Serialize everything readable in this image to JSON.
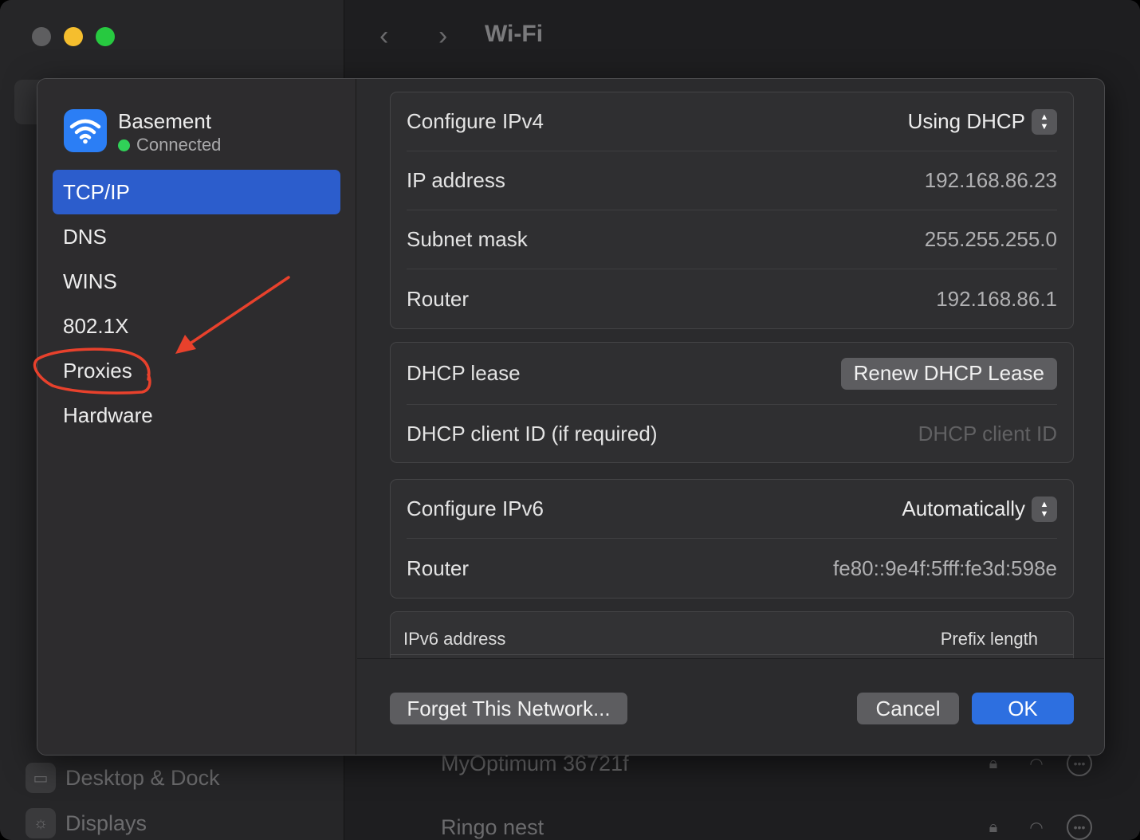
{
  "background_window": {
    "title": "Wi-Fi",
    "sidebar_rows": [
      {
        "label": "Desktop & Dock",
        "icon": "dock-icon"
      },
      {
        "label": "Displays",
        "icon": "displays-icon"
      }
    ],
    "networks": [
      {
        "name": "MyOptimum 36721f"
      },
      {
        "name": "Ringo nest"
      }
    ]
  },
  "sheet": {
    "network": {
      "name": "Basement",
      "status": "Connected"
    },
    "nav": [
      {
        "label": "TCP/IP",
        "active": true
      },
      {
        "label": "DNS"
      },
      {
        "label": "WINS"
      },
      {
        "label": "802.1X"
      },
      {
        "label": "Proxies"
      },
      {
        "label": "Hardware"
      }
    ],
    "ipv4": {
      "configure_label": "Configure IPv4",
      "configure_value": "Using DHCP",
      "ip_label": "IP address",
      "ip_value": "192.168.86.23",
      "subnet_label": "Subnet mask",
      "subnet_value": "255.255.255.0",
      "router_label": "Router",
      "router_value": "192.168.86.1"
    },
    "dhcp": {
      "lease_label": "DHCP lease",
      "renew_button": "Renew DHCP Lease",
      "client_id_label": "DHCP client ID (if required)",
      "client_id_placeholder": "DHCP client ID"
    },
    "ipv6": {
      "configure_label": "Configure IPv6",
      "configure_value": "Automatically",
      "router_label": "Router",
      "router_value": "fe80::9e4f:5fff:fe3d:598e"
    },
    "ipv6_table": {
      "columns": [
        "IPv6 address",
        "Prefix length"
      ]
    },
    "footer": {
      "forget_button": "Forget This Network...",
      "cancel_button": "Cancel",
      "ok_button": "OK"
    }
  },
  "colors": {
    "accent": "#2d6fe0",
    "selection": "#2c5dcc",
    "annotation": "#e8412c",
    "connected": "#30d158"
  }
}
